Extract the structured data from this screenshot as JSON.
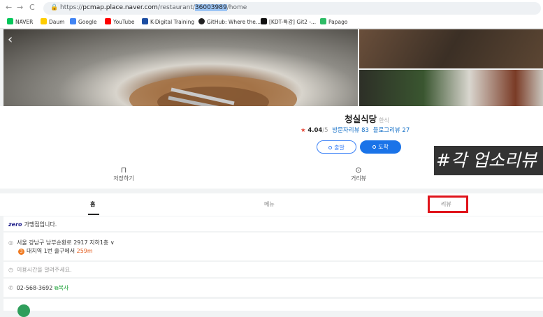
{
  "browser": {
    "url_prefix": "https://",
    "url_host": "pcmap.place.naver.com",
    "url_path": "/restaurant/",
    "url_selected": "36003989",
    "url_suffix": "/home",
    "nav": {
      "back": "←",
      "forward": "→",
      "reload": "C",
      "lock": "🔒"
    }
  },
  "bookmarks": [
    {
      "label": "NAVER",
      "color": "#03c75a"
    },
    {
      "label": "Daum",
      "color": "#ffcd00"
    },
    {
      "label": "Google",
      "color": "#4285f4"
    },
    {
      "label": "YouTube",
      "color": "#ff0000"
    },
    {
      "label": "K-Digital Training",
      "color": "#1d4fa3"
    },
    {
      "label": "GitHub: Where the...",
      "color": "#222222"
    },
    {
      "label": "[KDT-특강] Git2 -...",
      "color": "#111111"
    },
    {
      "label": "Papago",
      "color": "#2ebc66"
    }
  ],
  "place": {
    "name": "청실식당",
    "category": "한식",
    "star": "★",
    "rating": "4.04",
    "rating_max": "/5",
    "visitor_reviews": "방문자리뷰 83",
    "blog_reviews": "블로그리뷰 27",
    "start_label": "출발",
    "arrive_label": "도착",
    "back_icon": "‹"
  },
  "watermark": "#각 업소리뷰",
  "actions": {
    "save_icon": "⊓",
    "save_label": "저장하기",
    "distance_icon": "⊙",
    "distance_label": "거리뷰"
  },
  "tabs": {
    "home": "홈",
    "menu": "메뉴",
    "review": "리뷰"
  },
  "info": {
    "zero_brand": "zero",
    "zero_text": "가맹점입니다.",
    "address": "서울 강남구 남부순환로 2917 지하1층",
    "address_toggle": "∨",
    "subway_line": "3",
    "subway_text": "대치역 1번 출구에서",
    "subway_distance": "259m",
    "hours": "이용시간을 알려주세요.",
    "phone": "02-568-3692",
    "copy_label": "복사",
    "icon_pin": "◎",
    "icon_clock": "◷",
    "icon_phone": "✆",
    "icon_copy": "⧉"
  },
  "colors": {
    "accent": "#1a73e8",
    "highlight_box": "#e0141b",
    "star": "#e74c3c"
  }
}
